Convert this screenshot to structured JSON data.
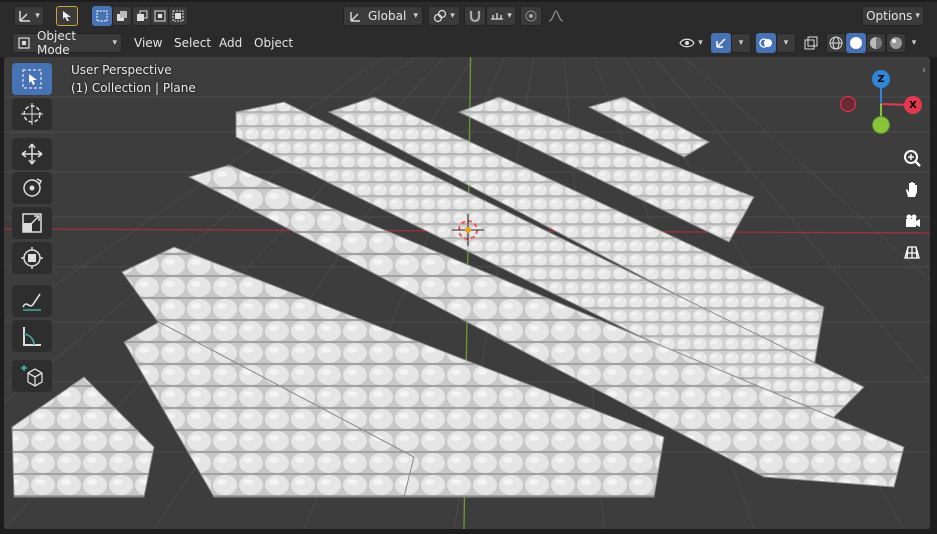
{
  "header": {
    "transform_orientation": "Global",
    "options_label": "Options"
  },
  "toolbar2": {
    "mode": "Object Mode",
    "menus": [
      "View",
      "Select",
      "Add",
      "Object"
    ]
  },
  "viewport": {
    "perspective_label": "User Perspective",
    "collection_label": "(1) Collection | Plane"
  },
  "gizmo": {
    "axes": [
      "Z",
      "X"
    ]
  },
  "colors": {
    "accent": "#4772b3",
    "x_axis": "#e2394f",
    "y_axis": "#8ac33b",
    "z_axis": "#2e86d6",
    "viewport_bg": "#3d3d3d"
  },
  "icons": {
    "left_toolbar": [
      "select-box-icon",
      "cursor-icon",
      "move-icon",
      "rotate-icon",
      "scale-icon",
      "transform-icon",
      "annotate-icon",
      "measure-icon",
      "add-cube-icon"
    ],
    "navigation": [
      "zoom-icon",
      "pan-hand-icon",
      "camera-icon",
      "grid-ortho-icon"
    ]
  }
}
